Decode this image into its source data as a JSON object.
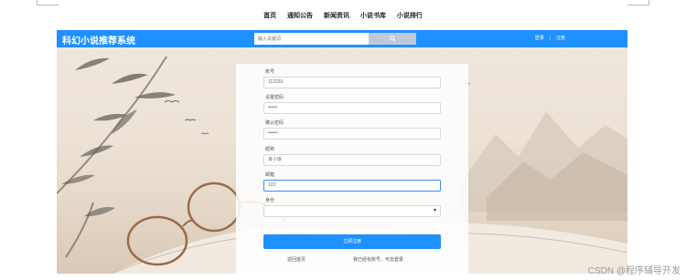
{
  "top_nav": {
    "items": [
      "首页",
      "通知公告",
      "新闻资讯",
      "小说书库",
      "小说排行"
    ]
  },
  "header": {
    "brand": "科幻小说推荐系统",
    "search_placeholder": "输入关键词",
    "search_icon": "search-icon",
    "login": "登录",
    "register": "注册",
    "color": "#1e90ff"
  },
  "form": {
    "account_label": "账号",
    "account_value": "112233",
    "password_label": "设置密码",
    "password_value": "••••••",
    "confirm_label": "确认密码",
    "confirm_value": "••••••",
    "nickname_label": "昵称",
    "nickname_value": "肖小饭",
    "email_label": "邮箱",
    "email_value": "123",
    "role_label": "身份",
    "role_value": "",
    "submit": "立即注册",
    "back_home": "返回首页",
    "has_account": "我已经有账号，可去登录"
  },
  "watermark": "CSDN @程序辅导开发"
}
